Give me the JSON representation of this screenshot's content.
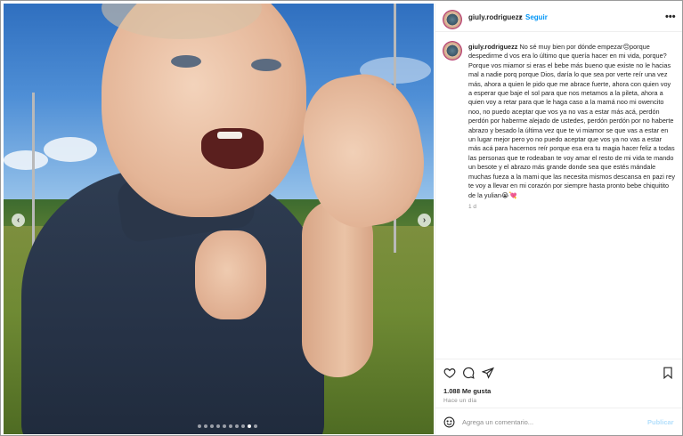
{
  "post": {
    "username": "giuly.rodriguezz",
    "separator": "•",
    "follow_label": "Seguir",
    "more_label": "•••",
    "caption_username": "giuly.rodriguezz",
    "caption_text": "No sé muy bien por dónde empezar😔porque despedirme d vos era lo último que quería hacer en mi vida, porque? Porque vos miamor si eras el bebe más bueno que existe no le hacias mal a nadie porq porque Dios, daría lo que sea por verte reír una vez más, ahora a quien le pido que me abrace fuerte, ahora con quien voy a esperar que baje el sol para que nos metamos a la pileta, ahora a quien voy a retar para que le haga caso a la mamá noo mi owencito noo, no puedo aceptar que vos ya no vas a estar más acá, perdón perdón por haberme alejado de ustedes, perdón perdón por no haberte abrazo y besado la última vez que te vi miamor se que vas a estar en un lugar mejor pero yo no puedo aceptar que vos ya no vas a estar más acá para hacernos reír porque esa era tu magia hacer feliz a todas las personas que te rodeaban te voy amar el resto de mi vida te mando un besote y el abrazo más grande donde sea que estés mándale muchas fueza a la mami que las necesita mismos descansa en pazi rey te voy a llevar en mi corazón por siempre hasta pronto bebe chiquitito de la yulian😭💘",
    "caption_age": "1 d",
    "likes_text": "1.088 Me gusta",
    "posted_text": "Hace un día"
  },
  "comment_box": {
    "placeholder": "Agrega un comentario...",
    "publish_label": "Publicar"
  },
  "carousel": {
    "prev_icon": "‹",
    "next_icon": "›",
    "slide_count": 10,
    "active_index": 8
  },
  "icons": {
    "like": "heart-icon",
    "comment": "comment-bubble-icon",
    "share": "paper-plane-icon",
    "save": "bookmark-icon",
    "emoji": "smiley-icon"
  },
  "colors": {
    "link_blue": "#0095f6",
    "publish_disabled": "#b2dffc",
    "meta_gray": "#8e8e8e",
    "text": "#262626"
  }
}
